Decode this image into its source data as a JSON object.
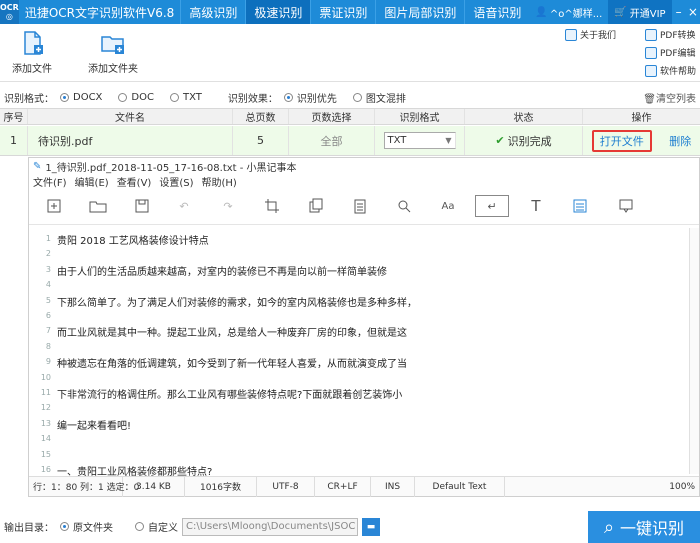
{
  "app": {
    "logo_top": "OCR",
    "logo_bottom": "◎",
    "title": "迅捷OCR文字识别软件V6.8",
    "tabs": [
      "高级识别",
      "极速识别",
      "票证识别",
      "图片局部识别",
      "语音识别"
    ],
    "active_tab": "极速识别",
    "user": "^o^娜样...",
    "vip": "开通VIP"
  },
  "toolbar": {
    "add_file": "添加文件",
    "add_folder": "添加文件夹",
    "about": "关于我们",
    "pdf_convert": "PDF转换",
    "pdf_edit": "PDF编辑",
    "software_help": "软件帮助"
  },
  "options": {
    "format_label": "识别格式：",
    "formats": [
      "DOCX",
      "DOC",
      "TXT"
    ],
    "selected_format": "DOCX",
    "effect_label": "识别效果：",
    "effects": [
      "识别优先",
      "图文混排"
    ],
    "selected_effect": "识别优先",
    "clear_list": "清空列表"
  },
  "table": {
    "headers": [
      "序号",
      "文件名",
      "总页数",
      "页数选择",
      "识别格式",
      "状态",
      "操作"
    ],
    "rows": [
      {
        "index": "1",
        "filename": "待识别.pdf",
        "pages": "5",
        "page_select": "全部",
        "format": "TXT",
        "status": "识别完成",
        "open": "打开文件",
        "delete": "删除"
      }
    ]
  },
  "notepad": {
    "title": "1_待识别.pdf_2018-11-05_17-16-08.txt - 小黑记事本",
    "menu": [
      "文件(F)",
      "编辑(E)",
      "查看(V)",
      "设置(S)",
      "帮助(H)"
    ],
    "line_numbers": [
      "1",
      "2",
      "3",
      "4",
      "5",
      "6",
      "7",
      "8",
      "9",
      "10",
      "11",
      "12",
      "13",
      "14",
      "15",
      "16"
    ],
    "lines": [
      "      贵阳      2018      工艺风格装修设计特点",
      "",
      "    由于人们的生活品质越来越高，对室内的装修已不再是向以前一样简单装修",
      "",
      "下那么简单了。为了满足人们对装修的需求，如今的室内风格装修也是多种多样，",
      "",
      "而工业风就是其中一种。提起工业风，总是给人一种废弃厂房的印象，但就是这",
      "",
      "种被遗忘在角落的低调建筑，如今受到了新一代年轻人喜爱，从而就演变成了当",
      "",
      "下非常流行的格调住所。那么工业风有哪些装修特点呢?下面就跟着创艺装饰小",
      "",
      "编一起来看看吧!",
      "",
      "",
      "    一、贵阳工业风格装修都那些特点?"
    ],
    "status": {
      "position": "行：1：80   列：1   选定：0",
      "size": "3.14 KB",
      "chars": "1016字数",
      "encoding": "UTF-8",
      "eol": "CR+LF",
      "mode": "INS",
      "font": "Default Text",
      "zoom": "100%"
    }
  },
  "output": {
    "label": "输出目录：",
    "opt_source": "原文件夹",
    "opt_custom": "自定义",
    "selected": "原文件夹",
    "path": "C:\\Users\\Mloong\\Documents\\JSOC",
    "recognize_button": "一键识别"
  },
  "colors": {
    "accent": "#1e8bd8",
    "success_row": "#eefbe9",
    "success_text": "#2e9d2e",
    "highlight": "#e53935"
  }
}
